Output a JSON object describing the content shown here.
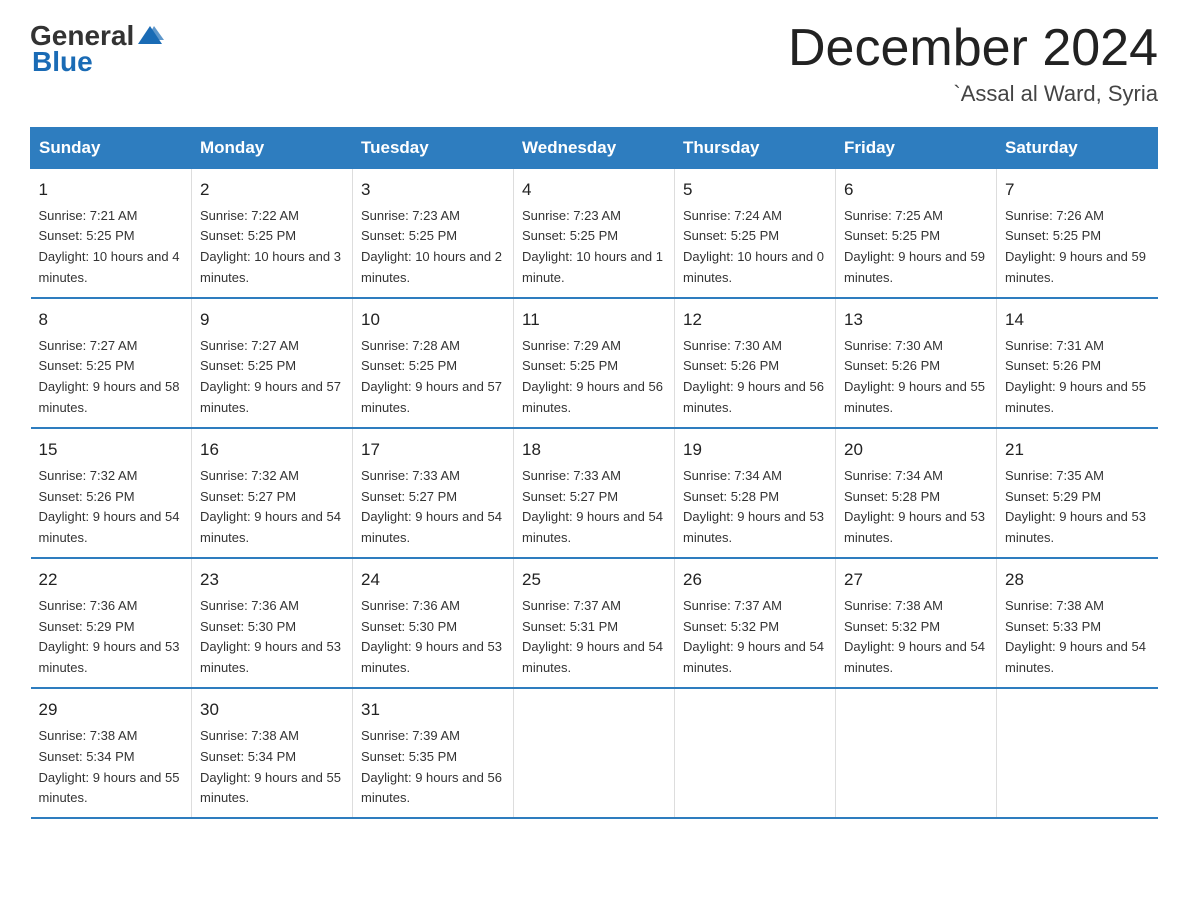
{
  "logo": {
    "general": "General",
    "blue": "Blue"
  },
  "title": "December 2024",
  "location": "`Assal al Ward, Syria",
  "weekdays": [
    "Sunday",
    "Monday",
    "Tuesday",
    "Wednesday",
    "Thursday",
    "Friday",
    "Saturday"
  ],
  "weeks": [
    [
      {
        "day": "1",
        "sunrise": "7:21 AM",
        "sunset": "5:25 PM",
        "daylight": "10 hours and 4 minutes."
      },
      {
        "day": "2",
        "sunrise": "7:22 AM",
        "sunset": "5:25 PM",
        "daylight": "10 hours and 3 minutes."
      },
      {
        "day": "3",
        "sunrise": "7:23 AM",
        "sunset": "5:25 PM",
        "daylight": "10 hours and 2 minutes."
      },
      {
        "day": "4",
        "sunrise": "7:23 AM",
        "sunset": "5:25 PM",
        "daylight": "10 hours and 1 minute."
      },
      {
        "day": "5",
        "sunrise": "7:24 AM",
        "sunset": "5:25 PM",
        "daylight": "10 hours and 0 minutes."
      },
      {
        "day": "6",
        "sunrise": "7:25 AM",
        "sunset": "5:25 PM",
        "daylight": "9 hours and 59 minutes."
      },
      {
        "day": "7",
        "sunrise": "7:26 AM",
        "sunset": "5:25 PM",
        "daylight": "9 hours and 59 minutes."
      }
    ],
    [
      {
        "day": "8",
        "sunrise": "7:27 AM",
        "sunset": "5:25 PM",
        "daylight": "9 hours and 58 minutes."
      },
      {
        "day": "9",
        "sunrise": "7:27 AM",
        "sunset": "5:25 PM",
        "daylight": "9 hours and 57 minutes."
      },
      {
        "day": "10",
        "sunrise": "7:28 AM",
        "sunset": "5:25 PM",
        "daylight": "9 hours and 57 minutes."
      },
      {
        "day": "11",
        "sunrise": "7:29 AM",
        "sunset": "5:25 PM",
        "daylight": "9 hours and 56 minutes."
      },
      {
        "day": "12",
        "sunrise": "7:30 AM",
        "sunset": "5:26 PM",
        "daylight": "9 hours and 56 minutes."
      },
      {
        "day": "13",
        "sunrise": "7:30 AM",
        "sunset": "5:26 PM",
        "daylight": "9 hours and 55 minutes."
      },
      {
        "day": "14",
        "sunrise": "7:31 AM",
        "sunset": "5:26 PM",
        "daylight": "9 hours and 55 minutes."
      }
    ],
    [
      {
        "day": "15",
        "sunrise": "7:32 AM",
        "sunset": "5:26 PM",
        "daylight": "9 hours and 54 minutes."
      },
      {
        "day": "16",
        "sunrise": "7:32 AM",
        "sunset": "5:27 PM",
        "daylight": "9 hours and 54 minutes."
      },
      {
        "day": "17",
        "sunrise": "7:33 AM",
        "sunset": "5:27 PM",
        "daylight": "9 hours and 54 minutes."
      },
      {
        "day": "18",
        "sunrise": "7:33 AM",
        "sunset": "5:27 PM",
        "daylight": "9 hours and 54 minutes."
      },
      {
        "day": "19",
        "sunrise": "7:34 AM",
        "sunset": "5:28 PM",
        "daylight": "9 hours and 53 minutes."
      },
      {
        "day": "20",
        "sunrise": "7:34 AM",
        "sunset": "5:28 PM",
        "daylight": "9 hours and 53 minutes."
      },
      {
        "day": "21",
        "sunrise": "7:35 AM",
        "sunset": "5:29 PM",
        "daylight": "9 hours and 53 minutes."
      }
    ],
    [
      {
        "day": "22",
        "sunrise": "7:36 AM",
        "sunset": "5:29 PM",
        "daylight": "9 hours and 53 minutes."
      },
      {
        "day": "23",
        "sunrise": "7:36 AM",
        "sunset": "5:30 PM",
        "daylight": "9 hours and 53 minutes."
      },
      {
        "day": "24",
        "sunrise": "7:36 AM",
        "sunset": "5:30 PM",
        "daylight": "9 hours and 53 minutes."
      },
      {
        "day": "25",
        "sunrise": "7:37 AM",
        "sunset": "5:31 PM",
        "daylight": "9 hours and 54 minutes."
      },
      {
        "day": "26",
        "sunrise": "7:37 AM",
        "sunset": "5:32 PM",
        "daylight": "9 hours and 54 minutes."
      },
      {
        "day": "27",
        "sunrise": "7:38 AM",
        "sunset": "5:32 PM",
        "daylight": "9 hours and 54 minutes."
      },
      {
        "day": "28",
        "sunrise": "7:38 AM",
        "sunset": "5:33 PM",
        "daylight": "9 hours and 54 minutes."
      }
    ],
    [
      {
        "day": "29",
        "sunrise": "7:38 AM",
        "sunset": "5:34 PM",
        "daylight": "9 hours and 55 minutes."
      },
      {
        "day": "30",
        "sunrise": "7:38 AM",
        "sunset": "5:34 PM",
        "daylight": "9 hours and 55 minutes."
      },
      {
        "day": "31",
        "sunrise": "7:39 AM",
        "sunset": "5:35 PM",
        "daylight": "9 hours and 56 minutes."
      },
      null,
      null,
      null,
      null
    ]
  ]
}
